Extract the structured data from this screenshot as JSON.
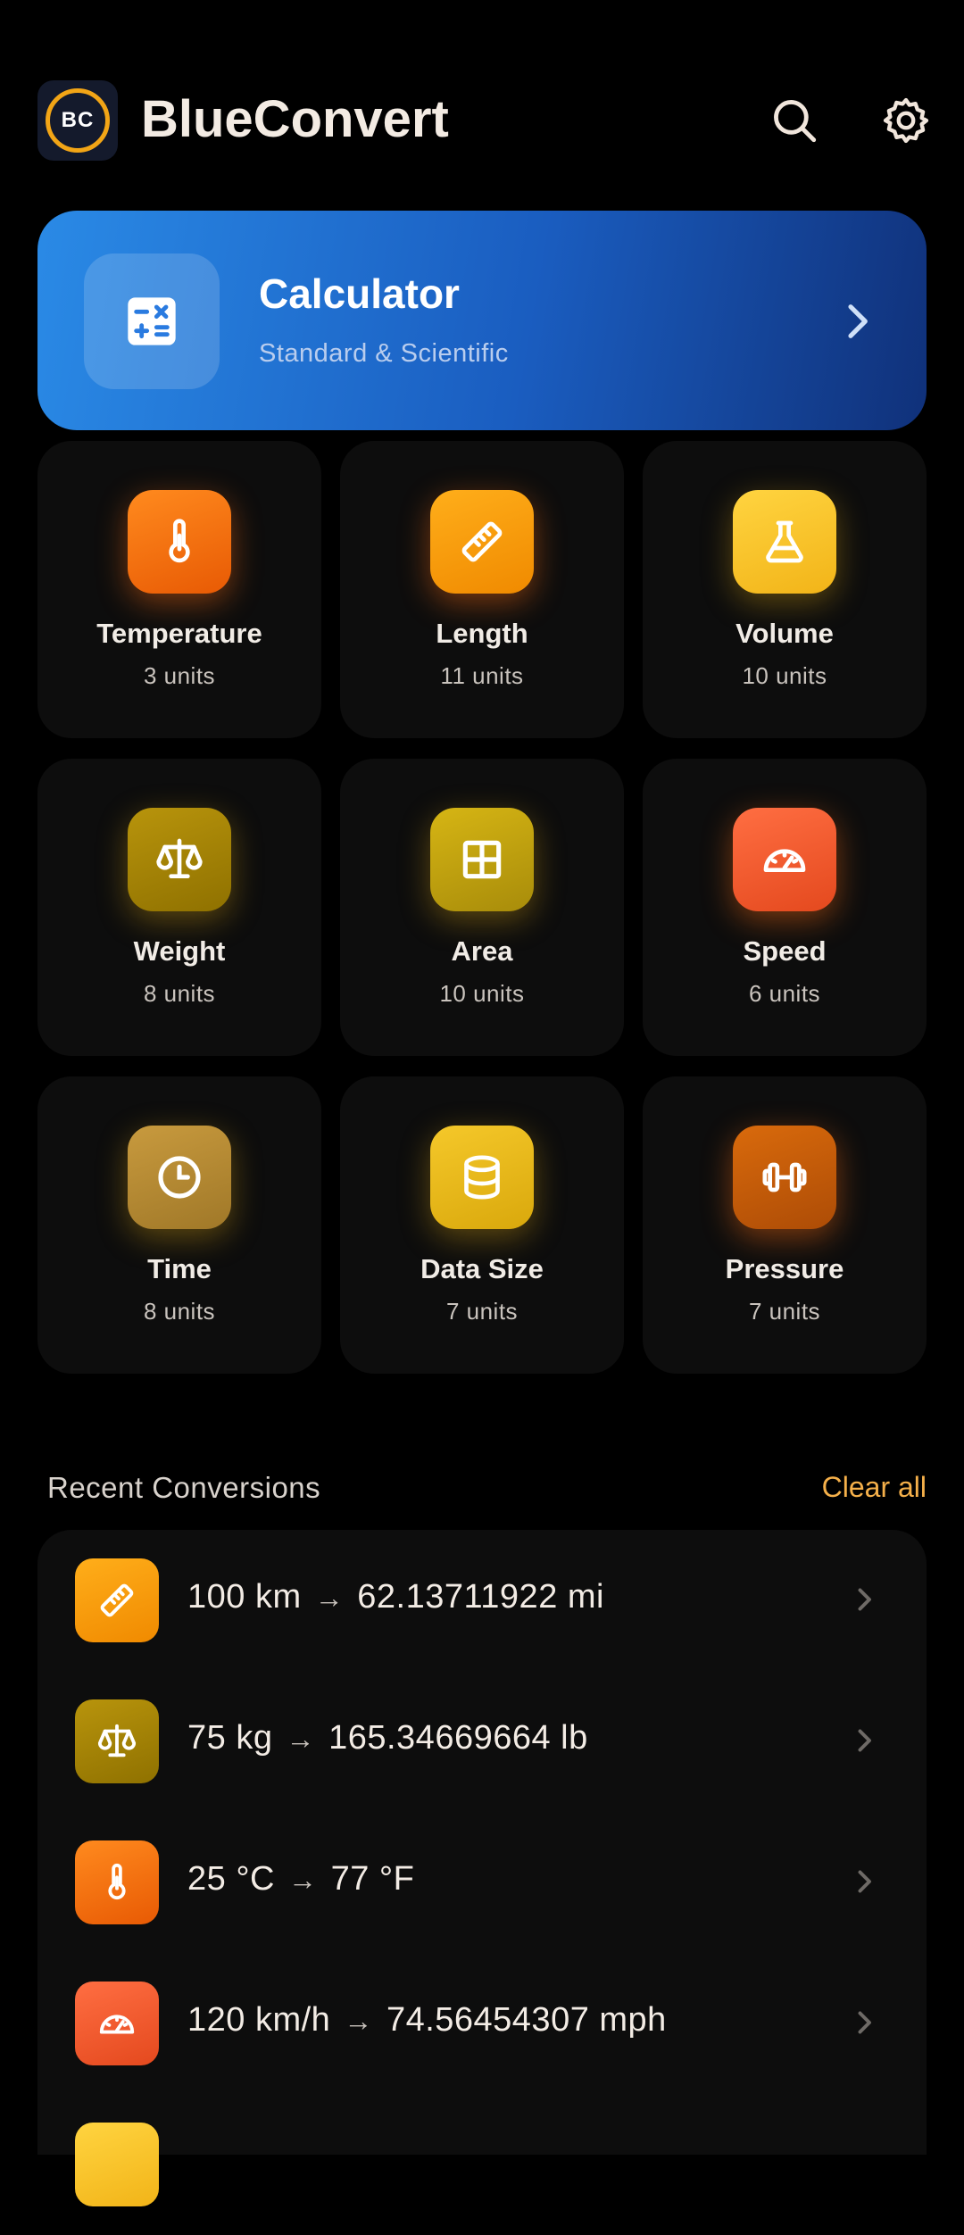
{
  "header": {
    "logo_text": "BC",
    "title": "BlueConvert",
    "search_icon": "search-icon",
    "settings_icon": "gear-icon"
  },
  "calculator": {
    "title": "Calculator",
    "subtitle": "Standard & Scientific",
    "icon": "calculator-icon"
  },
  "categories": [
    {
      "name": "Temperature",
      "units": "3 units",
      "icon": "thermometer-icon",
      "color": "#f06c0c"
    },
    {
      "name": "Length",
      "units": "11 units",
      "icon": "ruler-icon",
      "color": "#f89a0a"
    },
    {
      "name": "Volume",
      "units": "10 units",
      "icon": "flask-icon",
      "color": "#f8c42a"
    },
    {
      "name": "Weight",
      "units": "8 units",
      "icon": "scale-icon",
      "color": "#a88508"
    },
    {
      "name": "Area",
      "units": "10 units",
      "icon": "grid-icon",
      "color": "#c4a410"
    },
    {
      "name": "Speed",
      "units": "6 units",
      "icon": "speedometer-icon",
      "color": "#f45a30"
    },
    {
      "name": "Time",
      "units": "8 units",
      "icon": "clock-icon",
      "color": "#b88a34"
    },
    {
      "name": "Data Size",
      "units": "7 units",
      "icon": "database-icon",
      "color": "#e8b81c"
    },
    {
      "name": "Pressure",
      "units": "7 units",
      "icon": "dumbbell-icon",
      "color": "#c45a08"
    }
  ],
  "recent": {
    "title": "Recent Conversions",
    "clear_label": "Clear all",
    "items": [
      {
        "from": "100 km",
        "arrow": "→",
        "to": "62.13711922 mi",
        "icon": "ruler-icon"
      },
      {
        "from": "75 kg",
        "arrow": "→",
        "to": "165.34669664 lb",
        "icon": "scale-icon"
      },
      {
        "from": "25 °C",
        "arrow": "→",
        "to": "77 °F",
        "icon": "thermometer-icon"
      },
      {
        "from": "120 km/h",
        "arrow": "→",
        "to": "74.56454307 mph",
        "icon": "speedometer-icon"
      }
    ]
  }
}
